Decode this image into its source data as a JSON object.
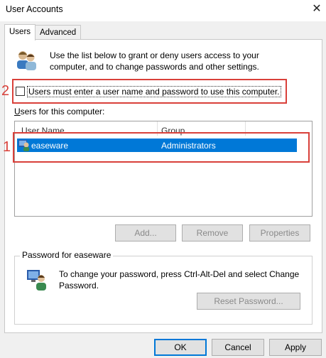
{
  "window": {
    "title": "User Accounts",
    "close_glyph": "✕"
  },
  "tabs": [
    {
      "label": "Users",
      "active": true
    },
    {
      "label": "Advanced",
      "active": false
    }
  ],
  "intro": {
    "icon": "users-icon",
    "text": "Use the list below to grant or deny users access to your computer, and to change passwords and other settings."
  },
  "require_login": {
    "checked": false,
    "label": "Users must enter a user name and password to use this computer."
  },
  "annotations": [
    "1",
    "2"
  ],
  "users_section": {
    "label_access_key": "U",
    "label_rest": "sers for this computer:",
    "columns": [
      "User Name",
      "Group"
    ],
    "rows": [
      {
        "user": "easeware",
        "group": "Administrators",
        "selected": true
      }
    ]
  },
  "buttons": {
    "add": "Add...",
    "remove": "Remove",
    "properties": "Properties"
  },
  "password_group": {
    "title": "Password for easeware",
    "text": "To change your password, press Ctrl-Alt-Del and select Change Password.",
    "reset_button": "Reset Password..."
  },
  "footer": {
    "ok": "OK",
    "cancel": "Cancel",
    "apply": "Apply"
  },
  "colors": {
    "selection": "#0078d7",
    "annotation": "#d9403a"
  }
}
